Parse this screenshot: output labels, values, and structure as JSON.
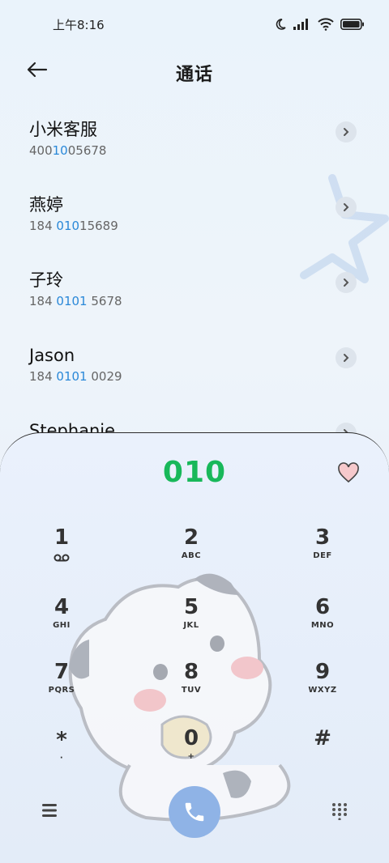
{
  "status_bar": {
    "time": "上午8:16"
  },
  "header": {
    "title": "通话"
  },
  "contacts": [
    {
      "name": "小米客服",
      "num_pre": "400",
      "num_hl": "10",
      "num_post": "05678"
    },
    {
      "name": "燕婷",
      "num_pre": "184 ",
      "num_hl": "010",
      "num_post": "15689"
    },
    {
      "name": "子玲",
      "num_pre": "184 ",
      "num_hl": "0101",
      "num_post": " 5678"
    },
    {
      "name": "Jason",
      "num_pre": "184 ",
      "num_hl": "0101",
      "num_post": " 0029"
    },
    {
      "name": "Stephanie",
      "num_pre": "",
      "num_hl": "",
      "num_post": ""
    }
  ],
  "dialpad": {
    "number": "010",
    "keys": [
      {
        "digit": "1",
        "letters": ""
      },
      {
        "digit": "2",
        "letters": "ABC"
      },
      {
        "digit": "3",
        "letters": "DEF"
      },
      {
        "digit": "4",
        "letters": "GHI"
      },
      {
        "digit": "5",
        "letters": "JKL"
      },
      {
        "digit": "6",
        "letters": "MNO"
      },
      {
        "digit": "7",
        "letters": "PQRS"
      },
      {
        "digit": "8",
        "letters": "TUV"
      },
      {
        "digit": "9",
        "letters": "WXYZ"
      },
      {
        "digit": "*",
        "letters": "·"
      },
      {
        "digit": "0",
        "letters": "+"
      },
      {
        "digit": "#",
        "letters": ""
      }
    ]
  },
  "colors": {
    "accent_green": "#18b85a",
    "highlight_blue": "#2a88d8",
    "call_button": "#8fb3e6"
  },
  "icons": [
    "moon-icon",
    "signal-icon",
    "wifi-icon",
    "battery-icon",
    "back-arrow-icon",
    "chevron-right-icon",
    "heart-icon",
    "voicemail-icon",
    "menu-icon",
    "phone-icon",
    "keypad-icon"
  ]
}
